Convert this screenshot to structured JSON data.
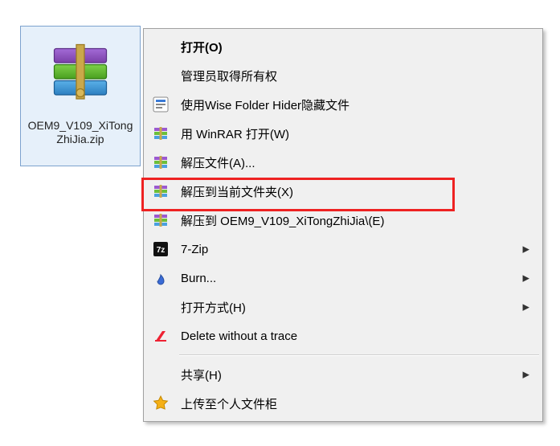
{
  "file": {
    "name": "OEM9_V109_XiTongZhiJia.zip"
  },
  "menu": {
    "open": "打开(O)",
    "admin": "管理员取得所有权",
    "wise_hider": "使用Wise Folder Hider隐藏文件",
    "winrar_open": "用 WinRAR 打开(W)",
    "extract_files": "解压文件(A)...",
    "extract_here": "解压到当前文件夹(X)",
    "extract_to_folder": "解压到 OEM9_V109_XiTongZhiJia\\(E)",
    "seven_zip": "7-Zip",
    "burn": "Burn...",
    "open_with": "打开方式(H)",
    "delete_trace": "Delete without a trace",
    "share": "共享(H)",
    "upload_cabinet": "上传至个人文件柜"
  },
  "highlight": {
    "target": "extract_here"
  }
}
